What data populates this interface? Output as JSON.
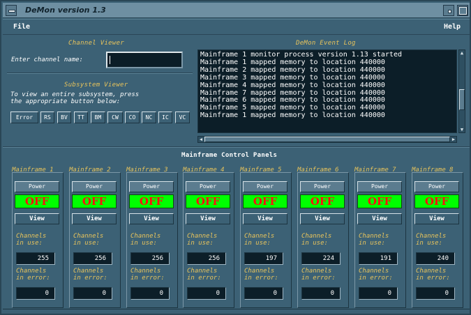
{
  "window": {
    "title": "DeMon   version 1.3"
  },
  "menu": {
    "file": "File",
    "help": "Help"
  },
  "channel_viewer": {
    "title": "Channel Viewer",
    "label": "Enter channel name:",
    "value": ""
  },
  "subsystem_viewer": {
    "title": "Subsystem Viewer",
    "instructions": "To view an entire subsystem, press\nthe appropriate button below:",
    "buttons": [
      "Error",
      "RS",
      "BV",
      "TT",
      "BM",
      "CW",
      "CO",
      "NC",
      "IC",
      "VC"
    ]
  },
  "event_log": {
    "title": "DeMon Event Log",
    "lines": [
      "Mainframe 1 monitor process version 1.13 started",
      "Mainframe 1 mapped memory to location 440000",
      "Mainframe 2 mapped memory to location 440000",
      "Mainframe 3 mapped memory to location 440000",
      "Mainframe 4 mapped memory to location 440000",
      "Mainframe 7 mapped memory to location 440000",
      "Mainframe 6 mapped memory to location 440000",
      "Mainframe 5 mapped memory to location 440000",
      "Mainframe 1 mapped memory to location 440000"
    ]
  },
  "control_panels": {
    "title": "Mainframe Control Panels",
    "power_label": "Power",
    "view_label": "View",
    "in_use_label": "Channels\nin use:",
    "in_error_label": "Channels\nin error:",
    "mainframes": [
      {
        "name": "Mainframe 1",
        "state": "OFF",
        "in_use": "255",
        "in_error": "0"
      },
      {
        "name": "Mainframe 2",
        "state": "OFF",
        "in_use": "256",
        "in_error": "0"
      },
      {
        "name": "Mainframe 3",
        "state": "OFF",
        "in_use": "256",
        "in_error": "0"
      },
      {
        "name": "Mainframe 4",
        "state": "OFF",
        "in_use": "256",
        "in_error": "0"
      },
      {
        "name": "Mainframe 5",
        "state": "OFF",
        "in_use": "197",
        "in_error": "0"
      },
      {
        "name": "Mainframe 6",
        "state": "OFF",
        "in_use": "224",
        "in_error": "0"
      },
      {
        "name": "Mainframe 7",
        "state": "OFF",
        "in_use": "191",
        "in_error": "0"
      },
      {
        "name": "Mainframe 8",
        "state": "OFF",
        "in_use": "240",
        "in_error": "0"
      }
    ]
  },
  "colors": {
    "background": "#3c6175",
    "accent_label": "#e8c45c",
    "off_bg": "#00ff00",
    "off_text": "#ff1010"
  }
}
